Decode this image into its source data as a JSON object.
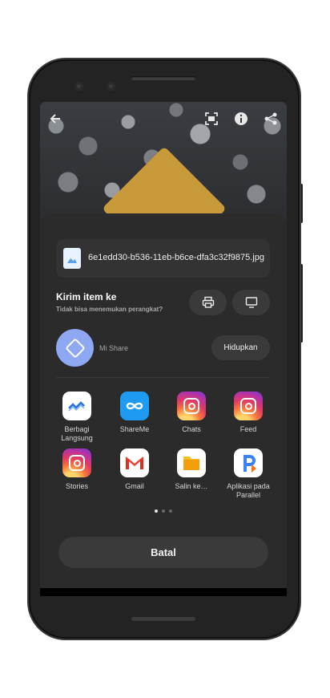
{
  "photo_toolbar": {
    "back_icon": "arrow-left-icon",
    "icons": [
      "screenshot-icon",
      "info-icon",
      "share-icon"
    ]
  },
  "file": {
    "name": "6e1edd30-b536-11eb-b6ce-dfa3c32f9875.jpg",
    "icon": "image-file-icon"
  },
  "send": {
    "title": "Kirim item ke",
    "subtitle": "Tidak bisa menemukan perangkat?",
    "print_icon": "printer-icon",
    "cast_icon": "monitor-icon"
  },
  "mishare": {
    "label": "Mi Share",
    "enable_label": "Hidupkan"
  },
  "apps": [
    {
      "label": "Berbagi Langsung",
      "icon": "direct-share-icon"
    },
    {
      "label": "ShareMe",
      "icon": "shareme-icon"
    },
    {
      "label": "Chats",
      "icon": "instagram-icon"
    },
    {
      "label": "Feed",
      "icon": "instagram-icon"
    },
    {
      "label": "Stories",
      "icon": "instagram-icon"
    },
    {
      "label": "Gmail",
      "icon": "gmail-icon"
    },
    {
      "label": "Salin ke…",
      "icon": "folder-icon"
    },
    {
      "label": "Aplikasi pada Parallel",
      "icon": "parallel-space-icon"
    }
  ],
  "pager": {
    "pages": 3,
    "active": 1
  },
  "cancel_label": "Batal",
  "colors": {
    "sheet_bg": "#2b2b2b",
    "button_bg": "#3a3a3a",
    "mishare_accent": "#8ea8f2"
  }
}
